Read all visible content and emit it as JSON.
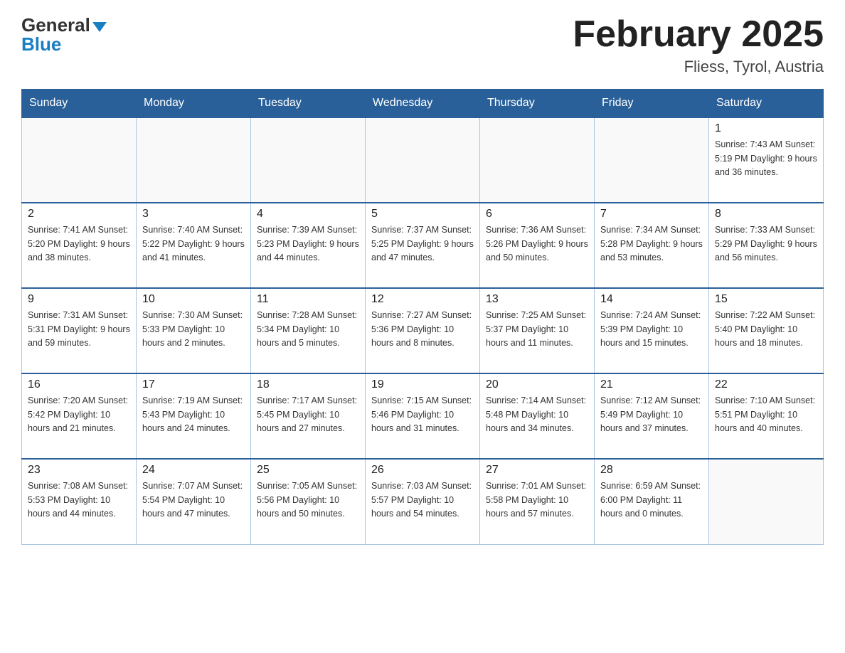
{
  "header": {
    "logo_general": "General",
    "logo_blue": "Blue",
    "month": "February 2025",
    "location": "Fliess, Tyrol, Austria"
  },
  "weekdays": [
    "Sunday",
    "Monday",
    "Tuesday",
    "Wednesday",
    "Thursday",
    "Friday",
    "Saturday"
  ],
  "weeks": [
    [
      {
        "day": "",
        "info": ""
      },
      {
        "day": "",
        "info": ""
      },
      {
        "day": "",
        "info": ""
      },
      {
        "day": "",
        "info": ""
      },
      {
        "day": "",
        "info": ""
      },
      {
        "day": "",
        "info": ""
      },
      {
        "day": "1",
        "info": "Sunrise: 7:43 AM\nSunset: 5:19 PM\nDaylight: 9 hours\nand 36 minutes."
      }
    ],
    [
      {
        "day": "2",
        "info": "Sunrise: 7:41 AM\nSunset: 5:20 PM\nDaylight: 9 hours\nand 38 minutes."
      },
      {
        "day": "3",
        "info": "Sunrise: 7:40 AM\nSunset: 5:22 PM\nDaylight: 9 hours\nand 41 minutes."
      },
      {
        "day": "4",
        "info": "Sunrise: 7:39 AM\nSunset: 5:23 PM\nDaylight: 9 hours\nand 44 minutes."
      },
      {
        "day": "5",
        "info": "Sunrise: 7:37 AM\nSunset: 5:25 PM\nDaylight: 9 hours\nand 47 minutes."
      },
      {
        "day": "6",
        "info": "Sunrise: 7:36 AM\nSunset: 5:26 PM\nDaylight: 9 hours\nand 50 minutes."
      },
      {
        "day": "7",
        "info": "Sunrise: 7:34 AM\nSunset: 5:28 PM\nDaylight: 9 hours\nand 53 minutes."
      },
      {
        "day": "8",
        "info": "Sunrise: 7:33 AM\nSunset: 5:29 PM\nDaylight: 9 hours\nand 56 minutes."
      }
    ],
    [
      {
        "day": "9",
        "info": "Sunrise: 7:31 AM\nSunset: 5:31 PM\nDaylight: 9 hours\nand 59 minutes."
      },
      {
        "day": "10",
        "info": "Sunrise: 7:30 AM\nSunset: 5:33 PM\nDaylight: 10 hours\nand 2 minutes."
      },
      {
        "day": "11",
        "info": "Sunrise: 7:28 AM\nSunset: 5:34 PM\nDaylight: 10 hours\nand 5 minutes."
      },
      {
        "day": "12",
        "info": "Sunrise: 7:27 AM\nSunset: 5:36 PM\nDaylight: 10 hours\nand 8 minutes."
      },
      {
        "day": "13",
        "info": "Sunrise: 7:25 AM\nSunset: 5:37 PM\nDaylight: 10 hours\nand 11 minutes."
      },
      {
        "day": "14",
        "info": "Sunrise: 7:24 AM\nSunset: 5:39 PM\nDaylight: 10 hours\nand 15 minutes."
      },
      {
        "day": "15",
        "info": "Sunrise: 7:22 AM\nSunset: 5:40 PM\nDaylight: 10 hours\nand 18 minutes."
      }
    ],
    [
      {
        "day": "16",
        "info": "Sunrise: 7:20 AM\nSunset: 5:42 PM\nDaylight: 10 hours\nand 21 minutes."
      },
      {
        "day": "17",
        "info": "Sunrise: 7:19 AM\nSunset: 5:43 PM\nDaylight: 10 hours\nand 24 minutes."
      },
      {
        "day": "18",
        "info": "Sunrise: 7:17 AM\nSunset: 5:45 PM\nDaylight: 10 hours\nand 27 minutes."
      },
      {
        "day": "19",
        "info": "Sunrise: 7:15 AM\nSunset: 5:46 PM\nDaylight: 10 hours\nand 31 minutes."
      },
      {
        "day": "20",
        "info": "Sunrise: 7:14 AM\nSunset: 5:48 PM\nDaylight: 10 hours\nand 34 minutes."
      },
      {
        "day": "21",
        "info": "Sunrise: 7:12 AM\nSunset: 5:49 PM\nDaylight: 10 hours\nand 37 minutes."
      },
      {
        "day": "22",
        "info": "Sunrise: 7:10 AM\nSunset: 5:51 PM\nDaylight: 10 hours\nand 40 minutes."
      }
    ],
    [
      {
        "day": "23",
        "info": "Sunrise: 7:08 AM\nSunset: 5:53 PM\nDaylight: 10 hours\nand 44 minutes."
      },
      {
        "day": "24",
        "info": "Sunrise: 7:07 AM\nSunset: 5:54 PM\nDaylight: 10 hours\nand 47 minutes."
      },
      {
        "day": "25",
        "info": "Sunrise: 7:05 AM\nSunset: 5:56 PM\nDaylight: 10 hours\nand 50 minutes."
      },
      {
        "day": "26",
        "info": "Sunrise: 7:03 AM\nSunset: 5:57 PM\nDaylight: 10 hours\nand 54 minutes."
      },
      {
        "day": "27",
        "info": "Sunrise: 7:01 AM\nSunset: 5:58 PM\nDaylight: 10 hours\nand 57 minutes."
      },
      {
        "day": "28",
        "info": "Sunrise: 6:59 AM\nSunset: 6:00 PM\nDaylight: 11 hours\nand 0 minutes."
      },
      {
        "day": "",
        "info": ""
      }
    ]
  ]
}
